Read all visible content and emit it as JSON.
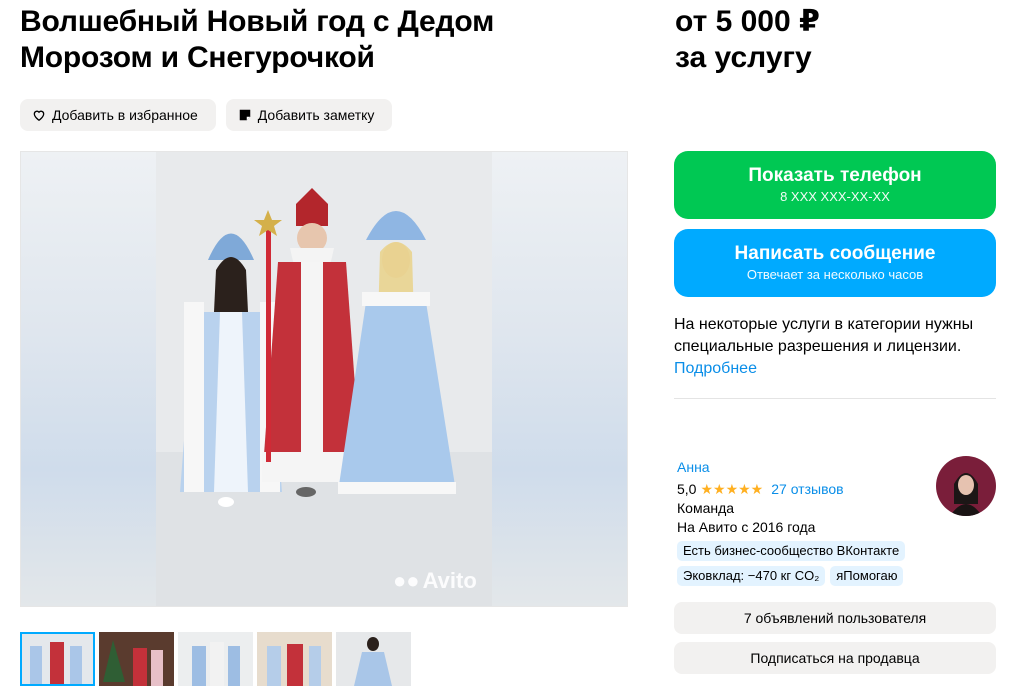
{
  "listing": {
    "title_line1": "Волшебный Новый год с Дедом",
    "title_line2": "Морозом и Снегурочкой",
    "price_line1": "от 5 000 ₽",
    "price_line2": "за услугу"
  },
  "actions": {
    "favorite_label": "Добавить в избранное",
    "note_label": "Добавить заметку"
  },
  "gallery": {
    "watermark": "Avito",
    "thumbnails": [
      "thumb-1",
      "thumb-2",
      "thumb-3",
      "thumb-4",
      "thumb-5"
    ],
    "active_index": 0
  },
  "contact": {
    "phone_label": "Показать телефон",
    "phone_masked": "8 XXX XXX-XX-XX",
    "message_label": "Написать сообщение",
    "message_sub": "Отвечает за несколько часов"
  },
  "notice": {
    "text": "На некоторые услуги в категории нужны специальные разрешения и лицензии.",
    "link": "Подробнее"
  },
  "seller": {
    "name": "Анна",
    "rating": "5,0",
    "stars": "★★★★★",
    "reviews": "27 отзывов",
    "type": "Команда",
    "since": "На Авито с 2016 года",
    "badges": [
      "Есть бизнес-сообщество ВКонтакте",
      "Эковклад: −470 кг CO₂",
      "яПомогаю"
    ],
    "ads_button": "7 объявлений пользователя",
    "subscribe_button": "Подписаться на продавца"
  },
  "colors": {
    "phone_button": "#00c853",
    "message_button": "#00aaff",
    "link": "#0a8ee8",
    "star": "#ffb021"
  }
}
